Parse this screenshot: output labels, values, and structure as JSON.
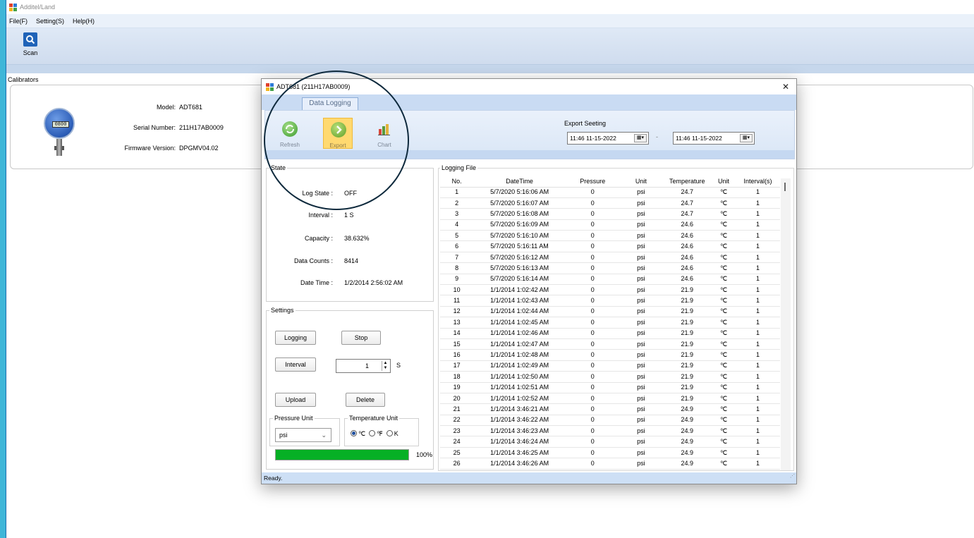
{
  "app": {
    "title": "Additel/Land",
    "menu": [
      "File(F)",
      "Setting(S)",
      "Help(H)"
    ],
    "toolbar": {
      "scan_label": "Scan"
    },
    "calibrators_label": "Calibrators",
    "device": {
      "model_label": "Model:",
      "model_value": "ADT681",
      "serial_label": "Serial Number:",
      "serial_value": "211H17AB0009",
      "firmware_label": "Firmware Version:",
      "firmware_value": "DPGMV04.02",
      "lcd_text": "0800"
    }
  },
  "dialog": {
    "title": "ADT681 (211H17AB0009)",
    "tab_label": "Data Logging",
    "ribbon": {
      "refresh_label": "Refresh",
      "export_label": "Export",
      "chart_label": "Chart"
    },
    "export": {
      "title": "Export Seeting",
      "from_value": "11:46 11-15-2022",
      "separator": "-",
      "to_value": "11:46 11-15-2022"
    },
    "state": {
      "group_label": "State",
      "log_state_label": "Log State :",
      "log_state_value": "OFF",
      "interval_label": "Interval :",
      "interval_value": "1 S",
      "capacity_label": "Capacity :",
      "capacity_value": "38.632%",
      "data_counts_label": "Data Counts :",
      "data_counts_value": "8414",
      "date_time_label": "Date Time :",
      "date_time_value": "1/2/2014 2:56:02 AM"
    },
    "settings": {
      "group_label": "Settings",
      "logging_label": "Logging",
      "stop_label": "Stop",
      "interval_label": "Interval",
      "interval_value": "1",
      "interval_unit": "S",
      "upload_label": "Upload",
      "delete_label": "Delete",
      "pressure_unit_label": "Pressure Unit",
      "pressure_unit_value": "psi",
      "temperature_unit_label": "Temperature Unit",
      "temp_c": "℃",
      "temp_f": "℉",
      "temp_k": "K",
      "progress_fraction": 1.0,
      "progress_text": "100%"
    },
    "logging_file": {
      "group_label": "Logging File",
      "columns": [
        "No.",
        "DateTime",
        "Pressure",
        "Unit",
        "Temperature",
        "Unit",
        "Interval(s)"
      ],
      "rows": [
        [
          "1",
          "5/7/2020 5:16:06 AM",
          "0",
          "psi",
          "24.7",
          "℃",
          "1"
        ],
        [
          "2",
          "5/7/2020 5:16:07 AM",
          "0",
          "psi",
          "24.7",
          "℃",
          "1"
        ],
        [
          "3",
          "5/7/2020 5:16:08 AM",
          "0",
          "psi",
          "24.7",
          "℃",
          "1"
        ],
        [
          "4",
          "5/7/2020 5:16:09 AM",
          "0",
          "psi",
          "24.6",
          "℃",
          "1"
        ],
        [
          "5",
          "5/7/2020 5:16:10 AM",
          "0",
          "psi",
          "24.6",
          "℃",
          "1"
        ],
        [
          "6",
          "5/7/2020 5:16:11 AM",
          "0",
          "psi",
          "24.6",
          "℃",
          "1"
        ],
        [
          "7",
          "5/7/2020 5:16:12 AM",
          "0",
          "psi",
          "24.6",
          "℃",
          "1"
        ],
        [
          "8",
          "5/7/2020 5:16:13 AM",
          "0",
          "psi",
          "24.6",
          "℃",
          "1"
        ],
        [
          "9",
          "5/7/2020 5:16:14 AM",
          "0",
          "psi",
          "24.6",
          "℃",
          "1"
        ],
        [
          "10",
          "1/1/2014 1:02:42 AM",
          "0",
          "psi",
          "21.9",
          "℃",
          "1"
        ],
        [
          "11",
          "1/1/2014 1:02:43 AM",
          "0",
          "psi",
          "21.9",
          "℃",
          "1"
        ],
        [
          "12",
          "1/1/2014 1:02:44 AM",
          "0",
          "psi",
          "21.9",
          "℃",
          "1"
        ],
        [
          "13",
          "1/1/2014 1:02:45 AM",
          "0",
          "psi",
          "21.9",
          "℃",
          "1"
        ],
        [
          "14",
          "1/1/2014 1:02:46 AM",
          "0",
          "psi",
          "21.9",
          "℃",
          "1"
        ],
        [
          "15",
          "1/1/2014 1:02:47 AM",
          "0",
          "psi",
          "21.9",
          "℃",
          "1"
        ],
        [
          "16",
          "1/1/2014 1:02:48 AM",
          "0",
          "psi",
          "21.9",
          "℃",
          "1"
        ],
        [
          "17",
          "1/1/2014 1:02:49 AM",
          "0",
          "psi",
          "21.9",
          "℃",
          "1"
        ],
        [
          "18",
          "1/1/2014 1:02:50 AM",
          "0",
          "psi",
          "21.9",
          "℃",
          "1"
        ],
        [
          "19",
          "1/1/2014 1:02:51 AM",
          "0",
          "psi",
          "21.9",
          "℃",
          "1"
        ],
        [
          "20",
          "1/1/2014 1:02:52 AM",
          "0",
          "psi",
          "21.9",
          "℃",
          "1"
        ],
        [
          "21",
          "1/1/2014 3:46:21 AM",
          "0",
          "psi",
          "24.9",
          "℃",
          "1"
        ],
        [
          "22",
          "1/1/2014 3:46:22 AM",
          "0",
          "psi",
          "24.9",
          "℃",
          "1"
        ],
        [
          "23",
          "1/1/2014 3:46:23 AM",
          "0",
          "psi",
          "24.9",
          "℃",
          "1"
        ],
        [
          "24",
          "1/1/2014 3:46:24 AM",
          "0",
          "psi",
          "24.9",
          "℃",
          "1"
        ],
        [
          "25",
          "1/1/2014 3:46:25 AM",
          "0",
          "psi",
          "24.9",
          "℃",
          "1"
        ],
        [
          "26",
          "1/1/2014 3:46:26 AM",
          "0",
          "psi",
          "24.9",
          "℃",
          "1"
        ]
      ]
    },
    "status_text": "Ready."
  },
  "colors": {
    "progress": "#06b025",
    "export_active": "#ffd970",
    "annotation_circle": "#0f2a3d"
  }
}
